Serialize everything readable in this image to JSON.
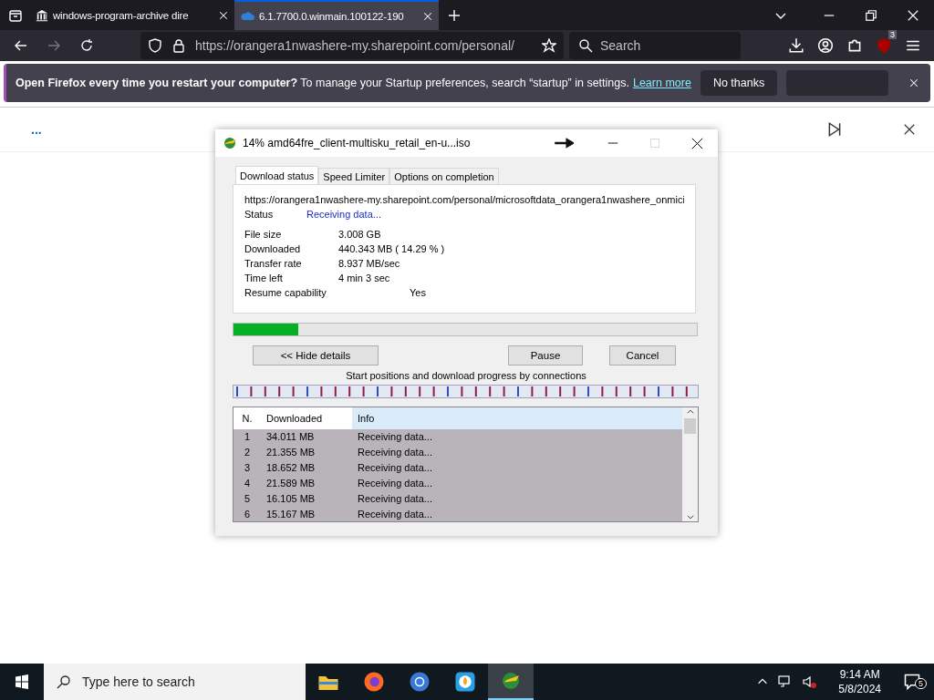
{
  "browser": {
    "tabs": [
      {
        "title": "windows-program-archive dire",
        "selected": false
      },
      {
        "title": "6.1.7700.0.winmain.100122-190",
        "selected": true
      }
    ],
    "url": "https://orangera1nwashere-my.sharepoint.com/personal/",
    "search": {
      "placeholder": "Search"
    },
    "extension_badge": "3",
    "notification": {
      "message": "**Open Firefox every time you restart your computer?** To manage your Startup preferences, search “startup” in settings.",
      "link": "Learn more",
      "button": "No thanks"
    },
    "page_toolbar": {
      "more": "..."
    }
  },
  "dialog": {
    "title": "14% amd64fre_client-multisku_retail_en-u...iso",
    "tabs": [
      {
        "label": "Download status",
        "selected": true
      },
      {
        "label": "Speed Limiter",
        "selected": false
      },
      {
        "label": "Options on completion",
        "selected": false
      }
    ],
    "url": "https://orangera1nwashere-my.sharepoint.com/personal/microsoftdata_orangera1nwashere_onmici",
    "status": {
      "label": "Status",
      "value": "Receiving data..."
    },
    "fields": [
      {
        "label": "File size",
        "value": "3.008  GB"
      },
      {
        "label": "Downloaded",
        "value": "440.343  MB  ( 14.29 % )"
      },
      {
        "label": "Transfer rate",
        "value": "8.937  MB/sec"
      },
      {
        "label": "Time left",
        "value": "4 min 3 sec"
      }
    ],
    "resume": {
      "label": "Resume capability",
      "value": "Yes"
    },
    "progress": {
      "level": 0.14
    },
    "buttons": [
      "<< Hide details",
      "Pause",
      "Cancel"
    ],
    "connections_caption": "Start positions and download progress by connections",
    "table": {
      "columns": [
        "N.",
        "Downloaded",
        "Info"
      ],
      "rows": [
        {
          "n": "1",
          "downloaded": "34.011  MB",
          "info": "Receiving data..."
        },
        {
          "n": "2",
          "downloaded": "21.355  MB",
          "info": "Receiving data..."
        },
        {
          "n": "3",
          "downloaded": "18.652  MB",
          "info": "Receiving data..."
        },
        {
          "n": "4",
          "downloaded": "21.589  MB",
          "info": "Receiving data..."
        },
        {
          "n": "5",
          "downloaded": "16.105  MB",
          "info": "Receiving data..."
        },
        {
          "n": "6",
          "downloaded": "15.167  MB",
          "info": "Receiving data..."
        }
      ]
    }
  },
  "taskbar": {
    "search": {
      "placeholder": "Type here to search"
    },
    "time": "9:14 AM",
    "date": "5/8/2024",
    "notifications": "5"
  }
}
